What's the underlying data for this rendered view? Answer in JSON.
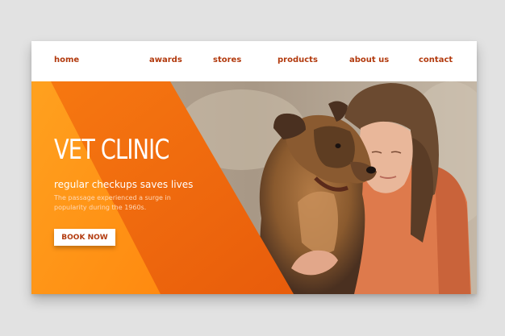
{
  "nav": {
    "items": [
      "home",
      "awards",
      "stores",
      "products",
      "about us",
      "contact"
    ]
  },
  "hero": {
    "title": "VET CLINIC",
    "subtitle": "regular checkups saves lives",
    "body": "The passage experienced a surge in popularity during the 1960s.",
    "cta_label": "BOOK NOW"
  },
  "colors": {
    "accent": "#f07a10",
    "accent_dark": "#e85a0a",
    "nav_text": "#b23a0e",
    "background": "#e2e2e2"
  },
  "image": {
    "subject": "woman hugging a dog"
  }
}
